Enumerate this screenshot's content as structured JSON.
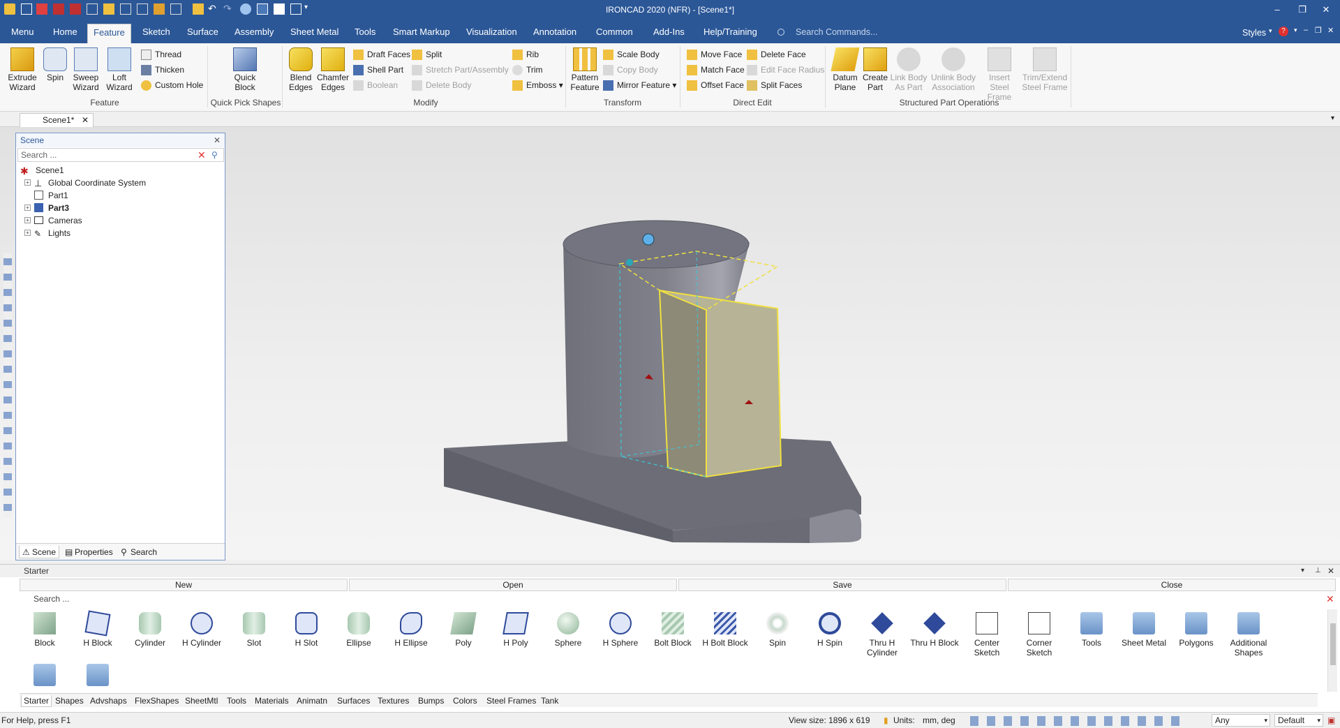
{
  "window": {
    "title": "IRONCAD 2020 (NFR) - [Scene1*]"
  },
  "tabs": [
    {
      "label": "Menu"
    },
    {
      "label": "Home"
    },
    {
      "label": "Feature"
    },
    {
      "label": "Sketch"
    },
    {
      "label": "Surface"
    },
    {
      "label": "Assembly"
    },
    {
      "label": "Sheet Metal"
    },
    {
      "label": "Tools"
    },
    {
      "label": "Smart Markup"
    },
    {
      "label": "Visualization"
    },
    {
      "label": "Annotation"
    },
    {
      "label": "Common"
    },
    {
      "label": "Add-Ins"
    },
    {
      "label": "Help/Training"
    }
  ],
  "active_tab": "Feature",
  "command_search": {
    "placeholder": "Search Commands..."
  },
  "styles_label": "Styles",
  "ribbon": {
    "feature": {
      "group_label": "Feature",
      "extrude": "Extrude\nWizard",
      "spin": "Spin",
      "sweep": "Sweep\nWizard",
      "loft": "Loft\nWizard",
      "thread": "Thread",
      "thicken": "Thicken",
      "custom_hole": "Custom Hole"
    },
    "quick": {
      "group_label": "Quick Pick Shapes",
      "quick_block": "Quick\nBlock"
    },
    "modify": {
      "group_label": "Modify",
      "blend": "Blend\nEdges",
      "chamfer": "Chamfer\nEdges",
      "draft_faces": "Draft Faces",
      "shell_part": "Shell Part",
      "boolean": "Boolean",
      "split": "Split",
      "stretch": "Stretch Part/Assembly",
      "delete_body": "Delete Body",
      "rib": "Rib",
      "trim": "Trim",
      "emboss": "Emboss"
    },
    "transform": {
      "group_label": "Transform",
      "pattern": "Pattern\nFeature",
      "scale_body": "Scale Body",
      "copy_body": "Copy Body",
      "mirror": "Mirror Feature"
    },
    "direct": {
      "group_label": "Direct Edit",
      "move_face": "Move Face",
      "match_face": "Match Face",
      "offset_face": "Offset Face",
      "delete_face": "Delete Face",
      "edit_radius": "Edit Face Radius",
      "split_faces": "Split Faces"
    },
    "structured": {
      "group_label": "Structured Part Operations",
      "datum": "Datum\nPlane",
      "create_part": "Create\nPart",
      "link_body": "Link Body\nAs Part",
      "unlink_body": "Unlink Body\nAssociation",
      "insert_steel": "Insert Steel\nFrame",
      "trim_steel": "Trim/Extend\nSteel Frame"
    }
  },
  "doc_tab": "Scene1*",
  "scene_panel": {
    "title": "Scene",
    "search_placeholder": "Search ...",
    "tree": [
      {
        "label": "Scene1",
        "level": 0,
        "bold": false
      },
      {
        "label": "Global Coordinate System",
        "level": 1,
        "bold": false
      },
      {
        "label": "Part1",
        "level": 1,
        "bold": false
      },
      {
        "label": "Part3",
        "level": 1,
        "bold": true
      },
      {
        "label": "Cameras",
        "level": 1,
        "bold": false
      },
      {
        "label": "Lights",
        "level": 1,
        "bold": false
      }
    ],
    "tabs": [
      "Scene",
      "Properties",
      "Search"
    ]
  },
  "starter_panel": {
    "title": "Starter",
    "commands": [
      "New",
      "Open",
      "Save",
      "Close"
    ],
    "search_placeholder": "Search ...",
    "shapes": [
      "Block",
      "H Block",
      "Cylinder",
      "H Cylinder",
      "Slot",
      "H Slot",
      "Ellipse",
      "H Ellipse",
      "Poly",
      "H Poly",
      "Sphere",
      "H Sphere",
      "Bolt Block",
      "H Bolt Block",
      "Spin",
      "H Spin",
      "Thru H\nCylinder",
      "Thru H Block",
      "Center\nSketch",
      "Corner\nSketch",
      "Tools",
      "Sheet Metal",
      "Polygons",
      "Additional\nShapes"
    ],
    "category_tabs": [
      "Starter",
      "Shapes",
      "Advshaps",
      "FlexShapes",
      "SheetMtl",
      "Tools",
      "Materials",
      "Animatn",
      "Surfaces",
      "Textures",
      "Bumps",
      "Colors",
      "Steel Frames",
      "Tank"
    ]
  },
  "status": {
    "help": "For Help, press F1",
    "view_size": "View size: 1896 x 619",
    "units_label": "Units:",
    "units_value": "mm, deg",
    "filter": "Any",
    "style": "Default"
  }
}
